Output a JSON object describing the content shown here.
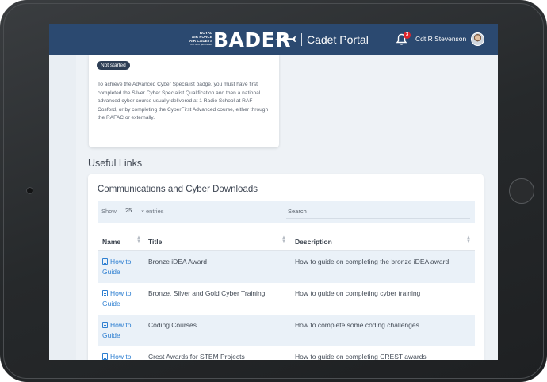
{
  "header": {
    "raf_logo_lines": [
      "ROYAL",
      "AIR FORCE",
      "AIR CADETS",
      "the next generation"
    ],
    "brand": "BADER",
    "portal": "Cadet Portal",
    "notifications_count": "3",
    "user_name": "Cdt R Stevenson"
  },
  "badge": {
    "status": "Not started",
    "description": "To achieve the Advanced Cyber Specialist badge, you must have first completed the Silver Cyber Specialist Qualification and then a national advanced cyber course usually delivered at 1 Radio School at RAF Cosford, or by completing the CyberFirst Advanced course, either through the RAFAC or externally."
  },
  "useful_links": {
    "section_title": "Useful Links",
    "card_title": "Communications and Cyber Downloads",
    "show_label": "Show",
    "show_value": "25",
    "entries_label": "entries",
    "search_label": "Search",
    "columns": [
      "Name",
      "Title",
      "Description"
    ],
    "rows": [
      {
        "name": "How to Guide",
        "title": "Bronze iDEA Award",
        "description": "How to guide on completing the bronze iDEA award"
      },
      {
        "name": "How to Guide",
        "title": "Bronze, Silver and Gold Cyber Training",
        "description": "How to guide on completing cyber training"
      },
      {
        "name": "How to Guide",
        "title": "Coding Courses",
        "description": "How to complete some coding challenges"
      },
      {
        "name": "How to Guide",
        "title": "Crest Awards for STEM Projects",
        "description": "How to guide on completing CREST awards"
      }
    ]
  },
  "colors": {
    "header_bg": "#2b4970",
    "link": "#2e7fd1",
    "row_alt": "#eaf1f8",
    "badge_red": "#e0262d"
  }
}
